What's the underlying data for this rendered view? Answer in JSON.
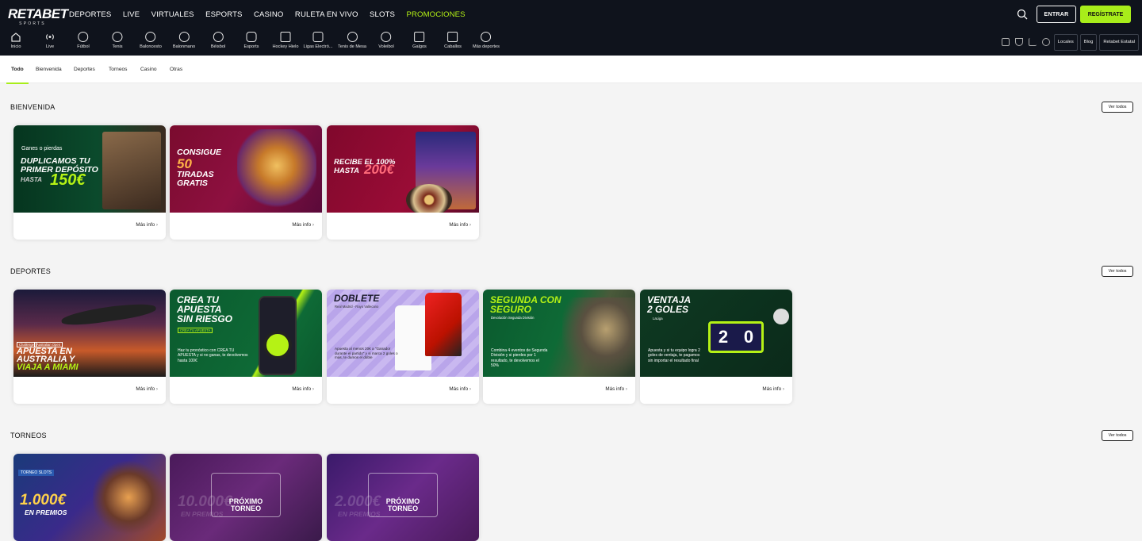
{
  "brand": {
    "logo": "RETABET",
    "logo_sub": "SPORTS"
  },
  "main_nav": [
    "DEPORTES",
    "LIVE",
    "VIRTUALES",
    "ESPORTS",
    "CASINO",
    "RULETA EN VIVO",
    "SLOTS",
    "PROMOCIONES"
  ],
  "auth": {
    "login": "ENTRAR",
    "register": "REGÍSTRATE"
  },
  "sports_nav": [
    "Inicio",
    "Live",
    "Fútbol",
    "Tenis",
    "Baloncesto",
    "Balonmano",
    "Béisbol",
    "Esports",
    "Hockey Hielo",
    "Ligas Electró...",
    "Tenis de Mesa",
    "Voleibol",
    "Galgos",
    "Caballos",
    "Más deportes"
  ],
  "right_nav": {
    "icons": [
      "calendar-icon",
      "trophy-icon",
      "stats-icon",
      "chat-icon"
    ],
    "buttons": [
      "Locales",
      "Blog",
      "Retabet Estatal"
    ]
  },
  "tabs": [
    "Todo",
    "Bienvenida",
    "Deportes",
    "Torneos",
    "Casino",
    "Otras"
  ],
  "sections": {
    "bienvenida": {
      "title": "BIENVENIDA",
      "ver_todos": "Ver todos",
      "cards": [
        {
          "lines": [
            "Ganes o pierdas",
            "DUPLICAMOS TU",
            "PRIMER DEPÓSITO",
            "HASTA",
            "150€"
          ],
          "more": "Más info"
        },
        {
          "lines": [
            "CONSIGUE",
            "50",
            "TIRADAS",
            "GRATIS"
          ],
          "more": "Más info"
        },
        {
          "lines": [
            "RECIBE EL 100%",
            "HASTA",
            "200€"
          ],
          "more": "Más info"
        }
      ]
    },
    "deportes": {
      "title": "DEPORTES",
      "ver_todos": "Ver todos",
      "cards": [
        {
          "lines": [
            "Challenge",
            "Australian Open",
            "APUESTA EN",
            "AUSTRALIA Y",
            "VIAJA A MIAMI"
          ],
          "more": "Más info"
        },
        {
          "lines": [
            "CREA TU",
            "APUESTA",
            "SIN RIESGO",
            "CREA TU APUESTA",
            "Haz tu pronóstico con CREA TU APUESTA y si no ganas, te devolvemos hasta 100€"
          ],
          "more": "Más info"
        },
        {
          "lines": [
            "DOBLETE",
            "Real Madrid - Rayo Vallecano",
            "Apuesta al menos 20€ a \"Ganador durante el partido\" y si marca 2 goles o más, te damos el doble"
          ],
          "more": "Más info"
        },
        {
          "lines": [
            "SEGUNDA CON",
            "SEGURO",
            "Devolución Segunda División",
            "Combina 4 eventos de Segunda División y si pierdes por 1 resultado, te devolvemos el 50%"
          ],
          "more": "Más info"
        },
        {
          "lines": [
            "VENTAJA",
            "2 GOLES",
            "LaLiga",
            "Apuesta y si tu equipo logra 2 goles de ventaja, te pagamos sin importar el resultado final",
            "2",
            "0"
          ],
          "more": "Más info"
        }
      ]
    },
    "torneos": {
      "title": "TORNEOS",
      "ver_todos": "Ver todos",
      "cards": [
        {
          "lines": [
            "TORNEO SLOTS",
            "1.000€",
            "EN PREMIOS"
          ]
        },
        {
          "lines": [
            "10.000€",
            "EN PREMIOS",
            "PRÓXIMO",
            "TORNEO"
          ]
        },
        {
          "lines": [
            "2.000€",
            "EN PREMIOS",
            "PRÓXIMO",
            "TORNEO"
          ]
        }
      ]
    }
  },
  "colors": {
    "accent": "#a8ed1a",
    "topbar": "#0f131c",
    "page_bg": "#f4f4f4"
  }
}
